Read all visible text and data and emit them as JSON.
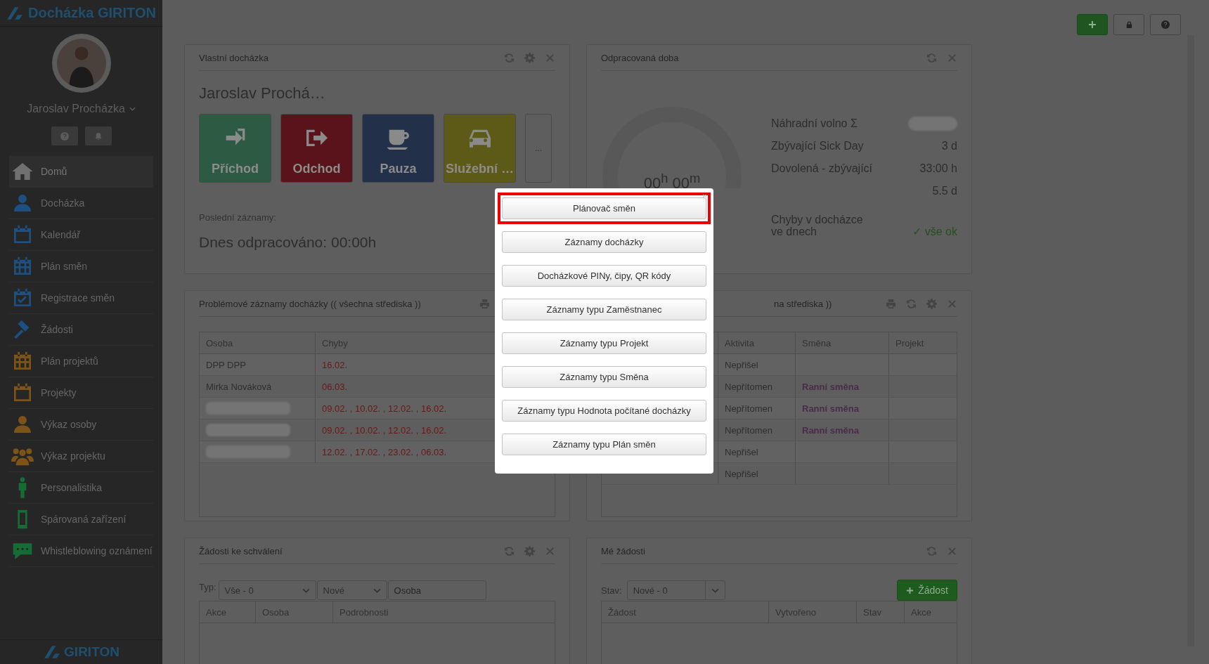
{
  "brand": {
    "logo_text": "Docházka GIRITON",
    "footer_logo": "GIRITON"
  },
  "user": {
    "name": "Jaroslav Procházka"
  },
  "sidebar": {
    "items": [
      {
        "label": "Domů",
        "color": "#707070",
        "selected": true
      },
      {
        "label": "Docházka",
        "color": "#1d4f80",
        "selected": false
      },
      {
        "label": "Kalendář",
        "color": "#1d4f80",
        "selected": false
      },
      {
        "label": "Plán směn",
        "color": "#1d4f80",
        "selected": false
      },
      {
        "label": "Registrace směn",
        "color": "#1d4f80",
        "selected": false
      },
      {
        "label": "Žádosti",
        "color": "#1d4f80",
        "selected": false
      },
      {
        "label": "Plán projektů",
        "color": "#7d5318",
        "selected": false
      },
      {
        "label": "Projekty",
        "color": "#7d5318",
        "selected": false
      },
      {
        "label": "Výkaz osoby",
        "color": "#7d5318",
        "selected": false
      },
      {
        "label": "Výkaz projektu",
        "color": "#7d5318",
        "selected": false
      },
      {
        "label": "Personalistika",
        "color": "#176b35",
        "selected": false
      },
      {
        "label": "Spárovaná zařízení",
        "color": "#176b35",
        "selected": false
      },
      {
        "label": "Whistleblowing oznámení",
        "color": "#176b35",
        "selected": false
      }
    ]
  },
  "own_attendance": {
    "title": "Vlastní docházka",
    "name": "Jaroslav Prochá…",
    "actions": [
      {
        "label": "Příchod",
        "color": "#2c5a42"
      },
      {
        "label": "Odchod",
        "color": "#5a121b"
      },
      {
        "label": "Pauza",
        "color": "#22304a"
      },
      {
        "label": "Služební …",
        "color": "#5c5a16"
      }
    ],
    "more": "...",
    "recent_label": "Poslední záznamy:",
    "today": "Dnes odpracováno: 00:00h"
  },
  "worked_time": {
    "title": "Odpracovaná doba",
    "total": "00$^{h}$ 00$^{m}$",
    "stats": [
      {
        "kind": "blurred",
        "label": "Náhradní volno Σ"
      },
      {
        "kind": "text",
        "label": "Zbývající Sick Day",
        "value": "3 d"
      },
      {
        "kind": "text",
        "label": "Dovolená - zbývající",
        "value": "33:00 h"
      },
      {
        "kind": "value",
        "value": "5.5 d"
      },
      {
        "kind": "ok",
        "label": "Chyby v docházce\nve dnech",
        "value": "✓ vše ok"
      }
    ]
  },
  "problem_records": {
    "title": "Problémové záznamy docházky (( všechna střediska ))",
    "columns": [
      "Osoba",
      "Chyby"
    ],
    "rows": [
      {
        "blurred": false,
        "person": "DPP DPP",
        "errors": "16.02."
      },
      {
        "blurred": false,
        "person": "Mirka Nováková",
        "errors": "06.03."
      },
      {
        "blurred": true,
        "errors": "09.02. , 10.02. , 12.02. , 16.02."
      },
      {
        "blurred": true,
        "errors": "09.02. , 10.02. , 12.02. , 16.02."
      },
      {
        "blurred": true,
        "errors": "12.02. , 17.02. , 23.02. , 06.03."
      }
    ]
  },
  "problem_records_2": {
    "title": "na střediska ))",
    "columns": [
      "Aktivita",
      "Směna",
      "Projekt"
    ],
    "rows": [
      {
        "activity": "Nepřišel"
      },
      {
        "activity": "Nepřítomen",
        "shift": "Ranní směna"
      },
      {
        "activity": "Nepřítomen",
        "shift": "Ranní směna"
      },
      {
        "activity": "Nepřítomen",
        "shift": "Ranní směna"
      },
      {
        "activity": "Nepřišel"
      },
      {
        "activity": "Nepřišel"
      }
    ]
  },
  "approvals": {
    "title": "Žádosti ke schválení",
    "type_label": "Typ:",
    "type_select": "Vše - 0",
    "state_select": "Nové",
    "person_placeholder": "Osoba",
    "columns": [
      "Akce",
      "Osoba",
      "Podrobnosti"
    ]
  },
  "my_requests": {
    "title": "Mé žádosti",
    "state_label": "Stav:",
    "state_select": "Nové - 0",
    "new_button": "Žádost",
    "columns": [
      "Žádost",
      "Vytvořeno",
      "Stav",
      "Akce"
    ]
  },
  "modal": {
    "items": [
      {
        "label": "Plánovač směn",
        "selected": true
      },
      {
        "label": "Záznamy docházky",
        "selected": false
      },
      {
        "label": "Docházkové PINy, čipy, QR kódy",
        "selected": false
      },
      {
        "label": "Záznamy typu Zaměstnanec",
        "selected": false
      },
      {
        "label": "Záznamy typu Projekt",
        "selected": false
      },
      {
        "label": "Záznamy typu Směna",
        "selected": false
      },
      {
        "label": "Záznamy typu Hodnota počítané docházky",
        "selected": false
      },
      {
        "label": "Záznamy typu Plán směn",
        "selected": false
      }
    ]
  }
}
